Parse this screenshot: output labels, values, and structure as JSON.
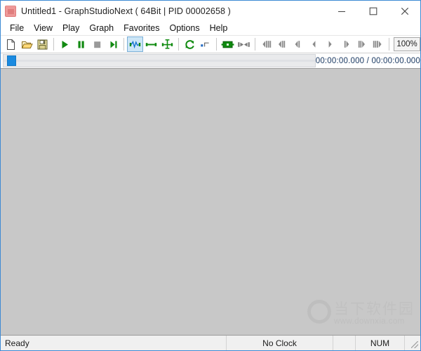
{
  "window": {
    "title": "Untitled1 - GraphStudioNext ( 64Bit | PID 00002658 )",
    "icon": "app-icon",
    "controls": {
      "minimize_label": "Minimize",
      "maximize_label": "Maximize",
      "close_label": "Close"
    }
  },
  "menu": {
    "items": [
      {
        "label": "File"
      },
      {
        "label": "View"
      },
      {
        "label": "Play"
      },
      {
        "label": "Graph"
      },
      {
        "label": "Favorites"
      },
      {
        "label": "Options"
      },
      {
        "label": "Help"
      }
    ]
  },
  "toolbar": {
    "zoom_value": "100%",
    "groups": [
      {
        "buttons": [
          {
            "name": "new-file-icon",
            "tip": "New"
          },
          {
            "name": "open-folder-icon",
            "tip": "Open"
          },
          {
            "name": "save-icon",
            "tip": "Save"
          }
        ]
      },
      {
        "buttons": [
          {
            "name": "play-icon",
            "tip": "Play"
          },
          {
            "name": "pause-icon",
            "tip": "Pause"
          },
          {
            "name": "stop-icon",
            "tip": "Stop"
          },
          {
            "name": "step-forward-icon",
            "tip": "Step Forward"
          }
        ]
      },
      {
        "buttons": [
          {
            "name": "graph-waveform-icon",
            "tip": "Graph View",
            "checked": true
          },
          {
            "name": "graph-connect-icon",
            "tip": "Connect Filters"
          },
          {
            "name": "graph-layout-icon",
            "tip": "Arrange Graph"
          }
        ]
      },
      {
        "buttons": [
          {
            "name": "refresh-icon",
            "tip": "Refresh"
          },
          {
            "name": "clock-step-icon",
            "tip": "Clock"
          }
        ]
      },
      {
        "buttons": [
          {
            "name": "insert-filter-icon",
            "tip": "Insert Filter"
          },
          {
            "name": "render-pin-icon",
            "tip": "Render Pin"
          }
        ]
      },
      {
        "buttons": [
          {
            "name": "seek-back-triple-icon",
            "tip": "Back x3"
          },
          {
            "name": "seek-back-double-icon",
            "tip": "Back x2"
          },
          {
            "name": "seek-back-single-icon",
            "tip": "Back x1"
          },
          {
            "name": "frame-prev-icon",
            "tip": "Previous Frame"
          },
          {
            "name": "frame-next-icon",
            "tip": "Next Frame"
          },
          {
            "name": "seek-fwd-single-icon",
            "tip": "Forward x1"
          },
          {
            "name": "seek-fwd-double-icon",
            "tip": "Forward x2"
          },
          {
            "name": "seek-fwd-triple-icon",
            "tip": "Forward x3"
          }
        ]
      }
    ]
  },
  "seek": {
    "position_percent": 0,
    "timecode": "00:00:00.000 / 00:00:00.000"
  },
  "watermark": {
    "chinese": "当下软件园",
    "url": "www.downxia.com"
  },
  "status": {
    "ready": "Ready",
    "clock": "No Clock",
    "num": "NUM"
  },
  "colors": {
    "window_border": "#3d8ad4",
    "client_bg": "#c8c8c8",
    "accent_green": "#119011",
    "slider_blue": "#1a8ae0",
    "toolbar_checked": "#cde6f7"
  }
}
